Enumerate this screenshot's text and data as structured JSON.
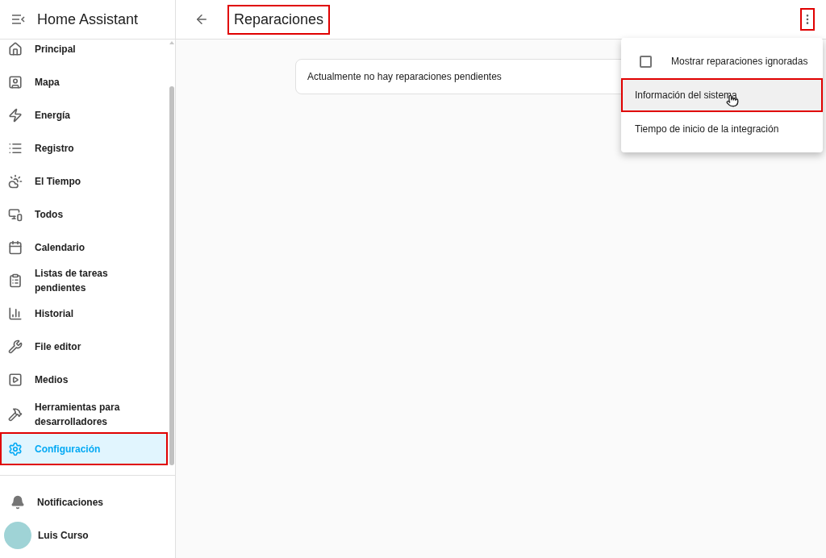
{
  "sidebar": {
    "title": "Home Assistant",
    "items": [
      {
        "label": "Principal",
        "selected": false,
        "annotated": false
      },
      {
        "label": "Mapa",
        "selected": false,
        "annotated": false
      },
      {
        "label": "Energía",
        "selected": false,
        "annotated": false
      },
      {
        "label": "Registro",
        "selected": false,
        "annotated": false
      },
      {
        "label": "El Tiempo",
        "selected": false,
        "annotated": false
      },
      {
        "label": "Todos",
        "selected": false,
        "annotated": false
      },
      {
        "label": "Calendario",
        "selected": false,
        "annotated": false
      },
      {
        "label": "Listas de tareas pendientes",
        "selected": false,
        "annotated": false
      },
      {
        "label": "Historial",
        "selected": false,
        "annotated": false
      },
      {
        "label": "File editor",
        "selected": false,
        "annotated": false
      },
      {
        "label": "Medios",
        "selected": false,
        "annotated": false
      },
      {
        "label": "Herramientas para desarrolladores",
        "selected": false,
        "annotated": false
      },
      {
        "label": "Configuración",
        "selected": true,
        "annotated": true
      }
    ],
    "notifications": "Notificaciones",
    "user": "Luis Curso"
  },
  "header": {
    "title": "Reparaciones",
    "title_annotated": true,
    "menu_annotated": true
  },
  "card": {
    "text": "Actualmente no hay reparaciones pendientes"
  },
  "menu": [
    {
      "kind": "checkbox",
      "label": "Mostrar reparaciones ignoradas",
      "checked": false,
      "hovered": false,
      "annotated": false
    },
    {
      "kind": "action",
      "label": "Información del sistema",
      "hovered": true,
      "annotated": true
    },
    {
      "kind": "action",
      "label": "Tiempo de inicio de la integración",
      "hovered": false,
      "annotated": false
    }
  ]
}
